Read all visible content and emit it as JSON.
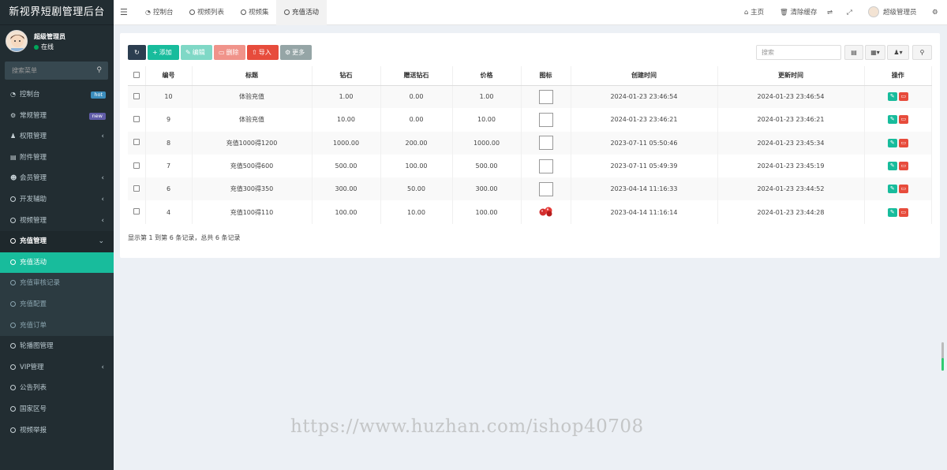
{
  "app": {
    "title": "新视界短剧管理后台"
  },
  "user": {
    "name": "超级管理员",
    "status": "在线"
  },
  "sidebar": {
    "search_placeholder": "搜索菜单",
    "items": [
      {
        "label": "控制台",
        "badge": "hot"
      },
      {
        "label": "常规管理",
        "badge": "new"
      },
      {
        "label": "权限管理"
      },
      {
        "label": "附件管理"
      },
      {
        "label": "会员管理"
      },
      {
        "label": "开发辅助"
      },
      {
        "label": "视频管理"
      },
      {
        "label": "充值管理"
      },
      {
        "label": "充值活动"
      },
      {
        "label": "充值审核记录"
      },
      {
        "label": "充值配置"
      },
      {
        "label": "充值订单"
      },
      {
        "label": "轮播图管理"
      },
      {
        "label": "VIP管理"
      },
      {
        "label": "公告列表"
      },
      {
        "label": "国家区号"
      },
      {
        "label": "视频举报"
      }
    ]
  },
  "header": {
    "tabs": [
      "控制台",
      "视频列表",
      "视频集",
      "充值活动"
    ],
    "home": "主页",
    "clear_cache": "清除缓存",
    "admin": "超级管理员"
  },
  "toolbar": {
    "add": "添加",
    "edit": "编辑",
    "delete": "删除",
    "import": "导入",
    "more": "更多",
    "search_placeholder": "搜索"
  },
  "table": {
    "columns": [
      "编号",
      "标题",
      "钻石",
      "赠送钻石",
      "价格",
      "图标",
      "创建时间",
      "更新时间",
      "操作"
    ],
    "rows": [
      {
        "id": "10",
        "title": "体验充值",
        "diamond": "1.00",
        "bonus": "0.00",
        "price": "1.00",
        "icon": "broken-image",
        "created": "2024-01-23 23:46:54",
        "updated": "2024-01-23 23:46:54"
      },
      {
        "id": "9",
        "title": "体验充值",
        "diamond": "10.00",
        "bonus": "0.00",
        "price": "10.00",
        "icon": "broken-image",
        "created": "2024-01-23 23:46:21",
        "updated": "2024-01-23 23:46:21"
      },
      {
        "id": "8",
        "title": "充值1000得1200",
        "diamond": "1000.00",
        "bonus": "200.00",
        "price": "1000.00",
        "icon": "broken-image",
        "created": "2023-07-11 05:50:46",
        "updated": "2024-01-23 23:45:34"
      },
      {
        "id": "7",
        "title": "充值500得600",
        "diamond": "500.00",
        "bonus": "100.00",
        "price": "500.00",
        "icon": "broken-image",
        "created": "2023-07-11 05:49:39",
        "updated": "2024-01-23 23:45:19"
      },
      {
        "id": "6",
        "title": "充值300得350",
        "diamond": "300.00",
        "bonus": "50.00",
        "price": "300.00",
        "icon": "broken-image",
        "created": "2023-04-14 11:16:33",
        "updated": "2024-01-23 23:44:52"
      },
      {
        "id": "4",
        "title": "充值100得110",
        "diamond": "100.00",
        "bonus": "10.00",
        "price": "100.00",
        "icon": "red-gems",
        "created": "2023-04-14 11:16:14",
        "updated": "2024-01-23 23:44:28"
      }
    ],
    "summary": "显示第 1 到第 6 条记录，总共 6 条记录"
  },
  "watermark": "https://www.huzhan.com/ishop40708",
  "colors": {
    "sidebar": "#222d32",
    "accent": "#18bc9c",
    "danger": "#e74c3c",
    "dark": "#2c3e50"
  }
}
